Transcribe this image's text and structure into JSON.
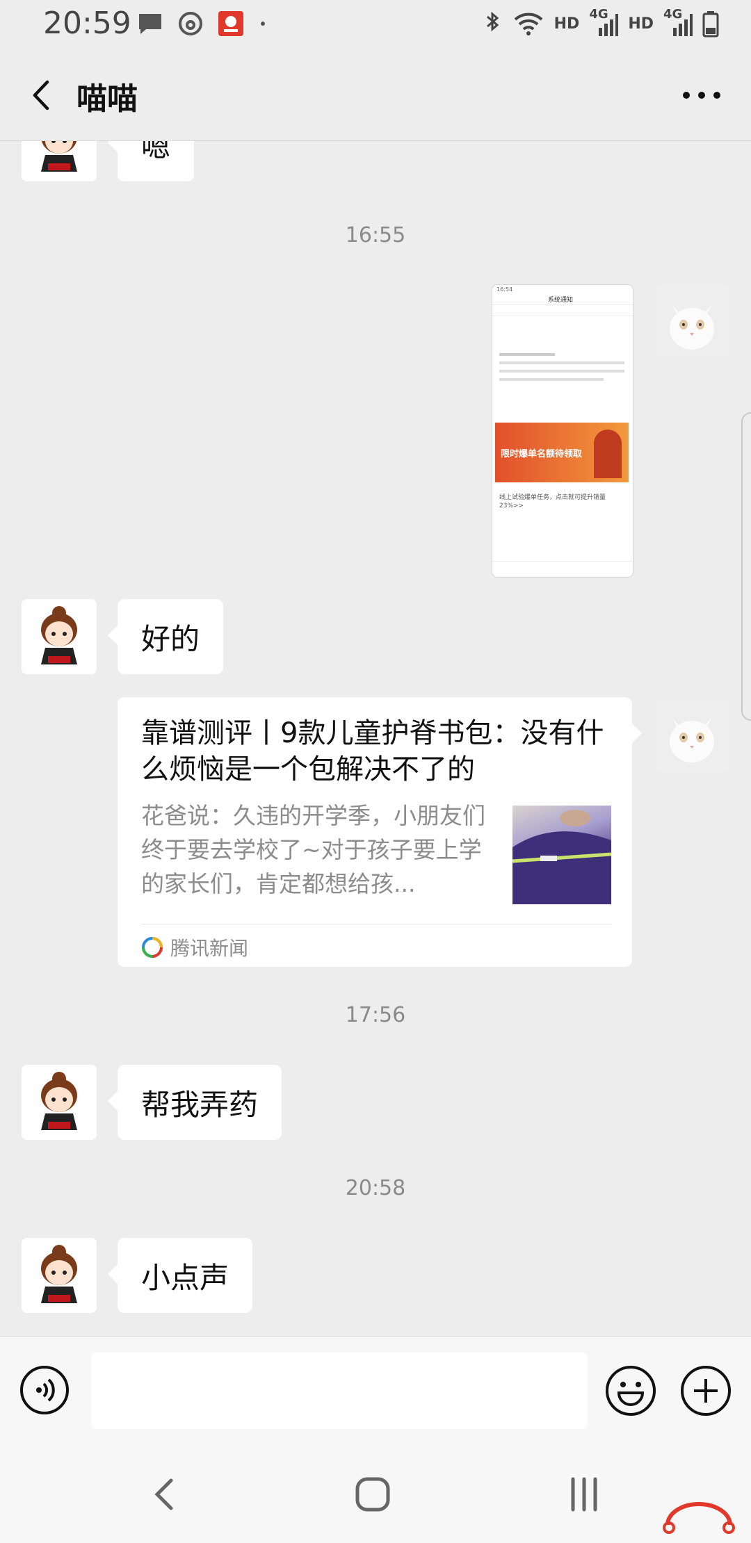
{
  "status_bar": {
    "time": "20:59",
    "network_1": "HD",
    "gen_1": "4G",
    "network_2": "HD",
    "gen_2": "4G"
  },
  "header": {
    "title": "喵喵"
  },
  "messages": {
    "m1": "嗯",
    "t1": "16:55",
    "m3": "好的",
    "t2": "17:56",
    "m5": "帮我弄药",
    "t3": "20:58",
    "m6": "小点声"
  },
  "link_card": {
    "title": "靠谱测评丨9款儿童护脊书包：没有什么烦恼是一个包解决不了的",
    "description": "花爸说：久违的开学季，小朋友们终于要去学校了~对于孩子要上学的家长们，肯定都想给孩...",
    "source": "腾讯新闻"
  },
  "screenshot_thumb": {
    "time": "16:54",
    "title": "系统通知",
    "banner_text": "限时爆单名额待领取",
    "body_text": "线上试验爆单任务，点击就可提升销量23%>>"
  },
  "colors": {
    "background": "#ededed",
    "bubble": "#ffffff",
    "timestamp": "#8a8a8a",
    "secondary_text": "#8c8c8c"
  }
}
